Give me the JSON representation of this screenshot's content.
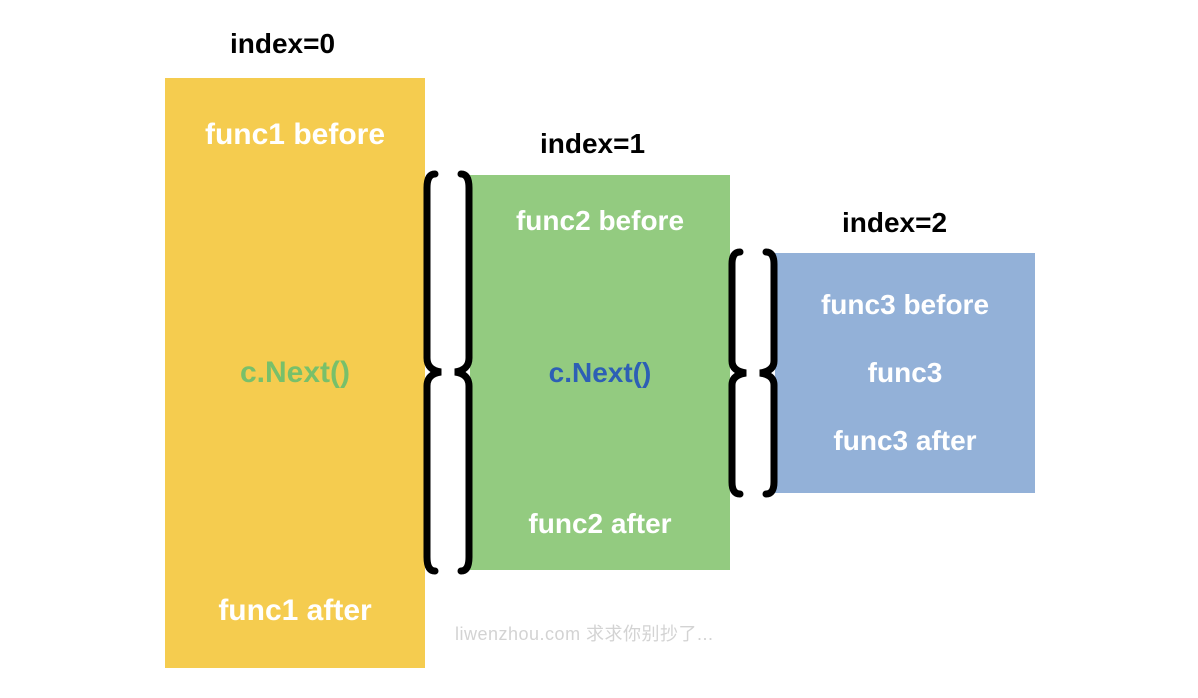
{
  "labels": {
    "index0": "index=0",
    "index1": "index=1",
    "index2": "index=2"
  },
  "box1": {
    "before": "func1 before",
    "next": "c.Next()",
    "after": "func1 after"
  },
  "box2": {
    "before": "func2 before",
    "next": "c.Next()",
    "after": "func2 after"
  },
  "box3": {
    "before": "func3 before",
    "body": "func3",
    "after": "func3 after"
  },
  "watermark": "liwenzhou.com  求求你别抄了..."
}
